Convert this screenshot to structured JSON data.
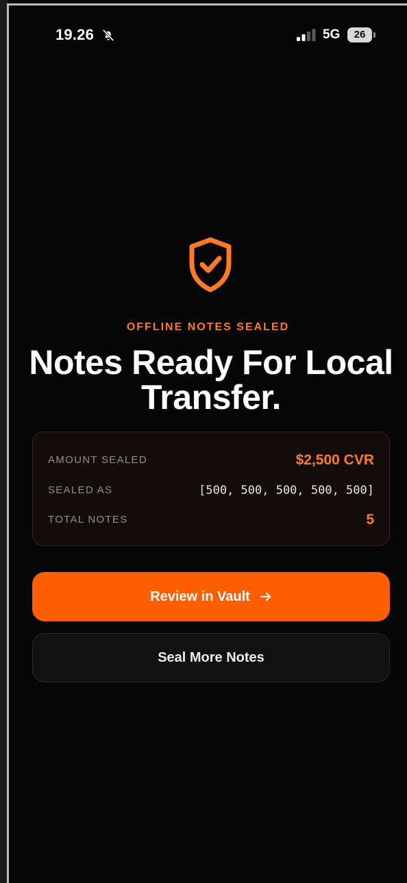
{
  "status_bar": {
    "time": "19.26",
    "network": "5G",
    "battery": "26"
  },
  "hero": {
    "eyebrow": "OFFLINE NOTES SEALED",
    "headline": "Notes Ready For Local Transfer."
  },
  "summary": {
    "rows": [
      {
        "label": "AMOUNT SEALED",
        "value": "$2,500 CVR"
      },
      {
        "label": "SEALED AS",
        "value": "[500, 500, 500, 500, 500]"
      },
      {
        "label": "TOTAL NOTES",
        "value": "5"
      }
    ]
  },
  "actions": {
    "primary_label": "Review in Vault",
    "secondary_label": "Seal More Notes"
  },
  "icons": {
    "hero": "shield-check-icon",
    "primary_action": "arrow-right-icon",
    "status": [
      "bell-off-icon",
      "signal-icon",
      "battery-icon"
    ]
  },
  "colors": {
    "accent": "#ff7a26",
    "primary_button": "#ff5f00",
    "background": "#060606",
    "card_background": "#120d0a",
    "card_border": "#3a261a"
  }
}
